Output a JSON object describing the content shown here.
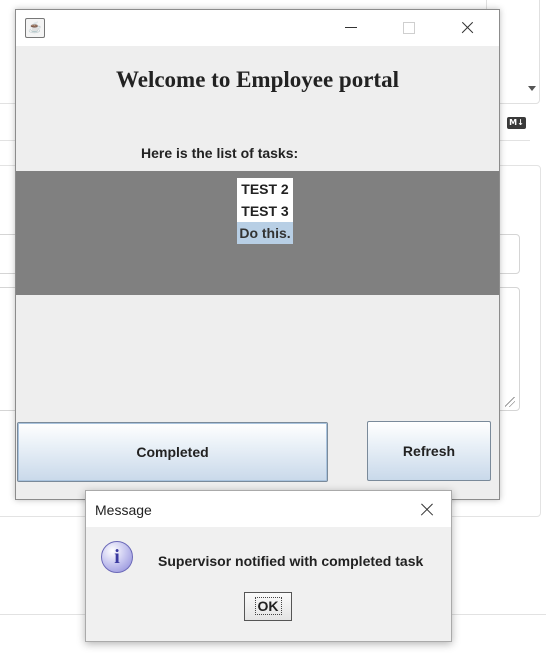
{
  "background": {
    "markdown_badge": "M↓"
  },
  "main_window": {
    "java_icon": "java-cup-icon",
    "heading": "Welcome to Employee portal",
    "subheading": "Here is the list of tasks:",
    "tasks": [
      "TEST 2",
      "TEST 3",
      "Do this."
    ],
    "selected_task": "Do this.",
    "completed_button": "Completed",
    "refresh_button": "Refresh"
  },
  "dialog": {
    "title": "Message",
    "icon": "information-icon",
    "message": "Supervisor notified with completed task",
    "ok_button": "OK"
  }
}
